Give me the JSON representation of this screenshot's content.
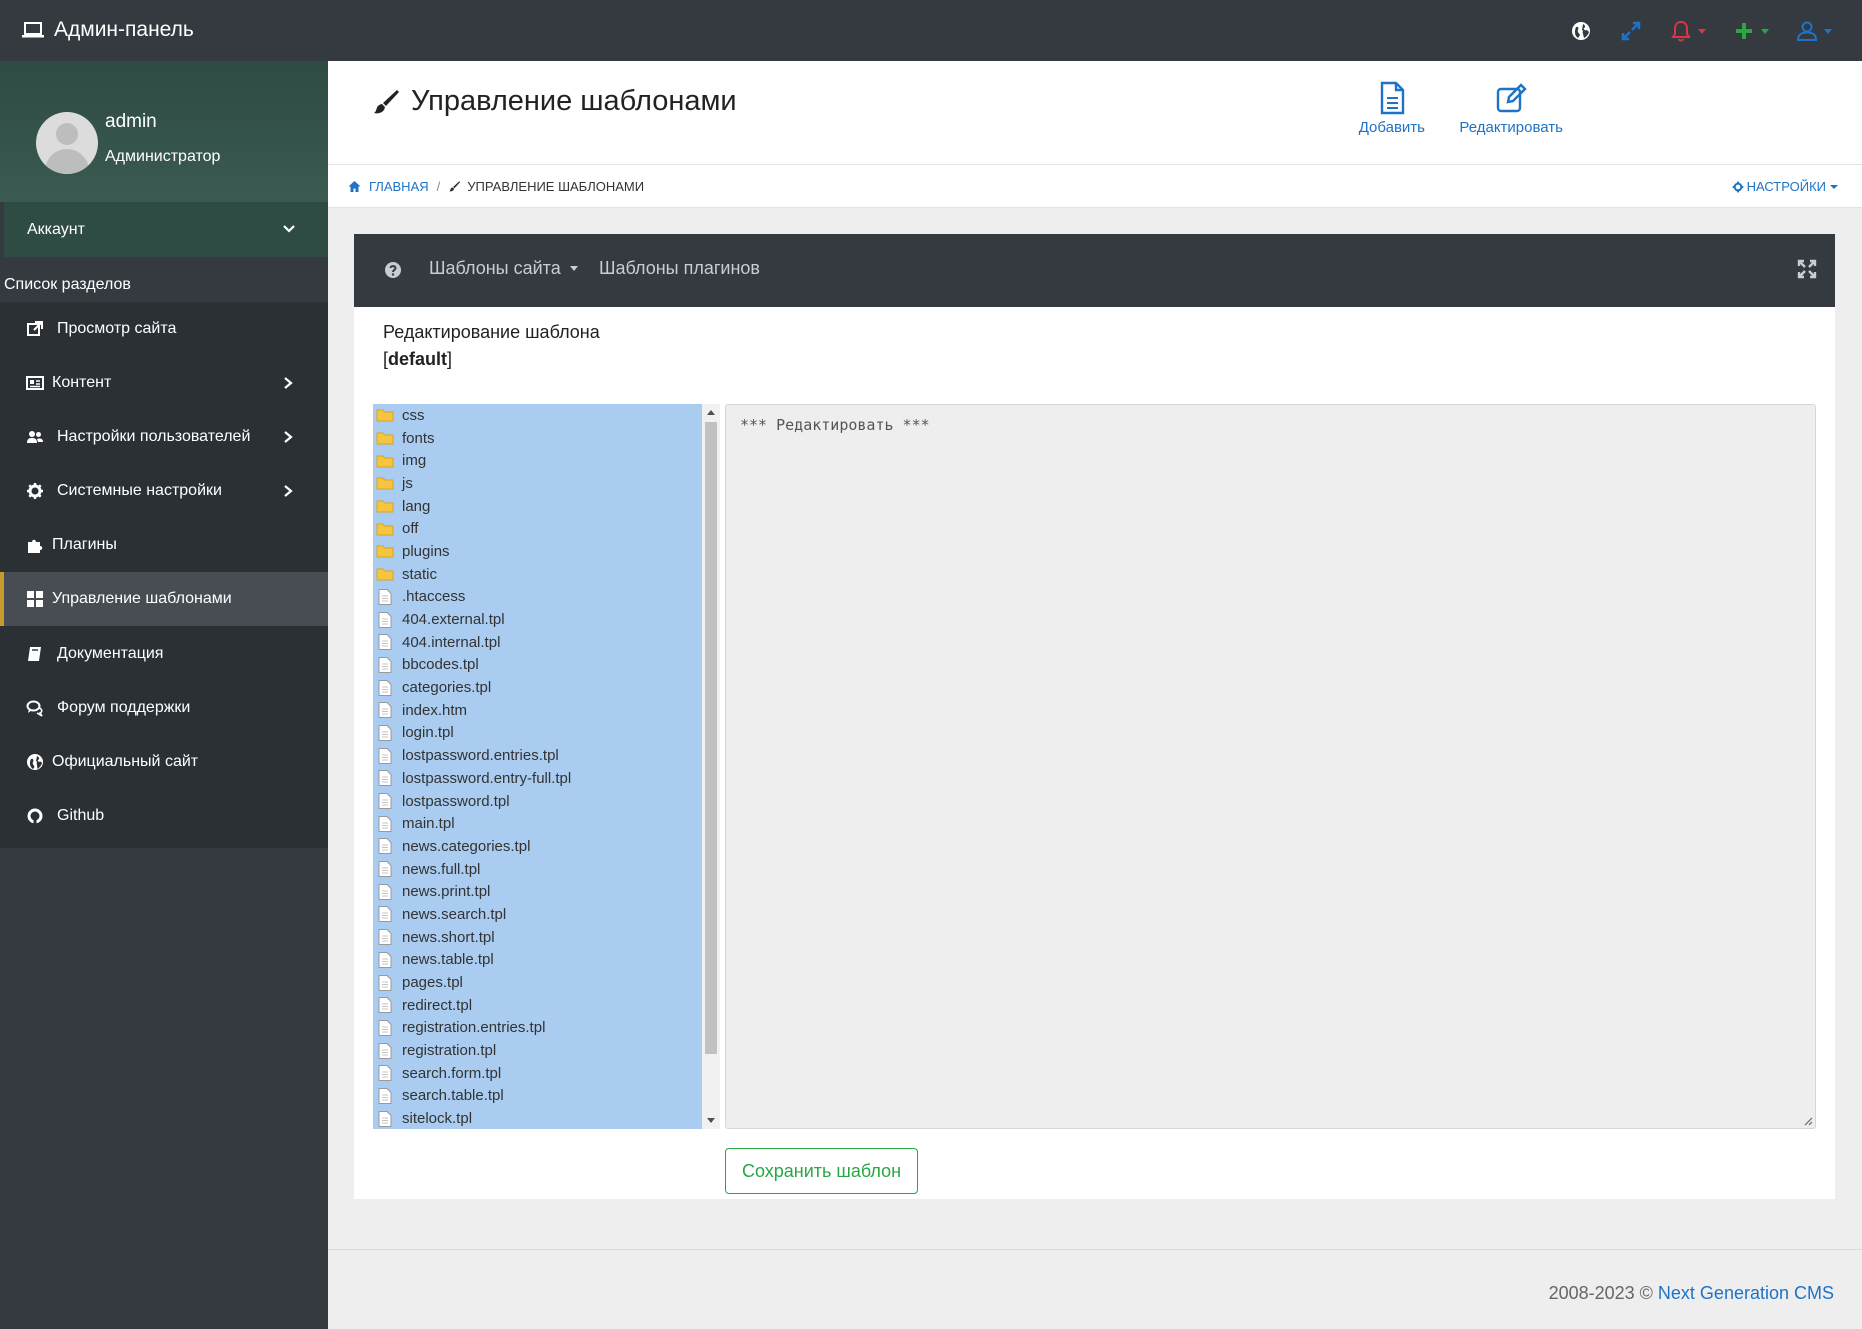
{
  "app": {
    "title": "Админ-панель"
  },
  "top_icons": [
    {
      "icon": "globe-icon",
      "color": "#ffffff"
    },
    {
      "icon": "expand-arrows-icon",
      "color": "#1e73c6"
    },
    {
      "icon": "bell-icon",
      "color": "#dc3545"
    },
    {
      "icon": "plus-icon",
      "color": "#28a745"
    },
    {
      "icon": "user-icon",
      "color": "#1e73c6"
    }
  ],
  "sidebar": {
    "user_name": "admin",
    "user_role": "Администратор",
    "account_label": "Аккаунт",
    "section_title": "Список разделов",
    "items": [
      {
        "label": "Просмотр сайта",
        "icon": "external-link-icon"
      },
      {
        "label": "Контент",
        "icon": "newspaper-icon"
      },
      {
        "label": "Настройки пользователей",
        "icon": "users-icon"
      },
      {
        "label": "Системные настройки",
        "icon": "cog-icon"
      },
      {
        "label": "Плагины",
        "icon": "puzzle-icon"
      },
      {
        "label": "Управление шаблонами",
        "icon": "th-large-icon"
      },
      {
        "label": "Документация",
        "icon": "book-icon"
      },
      {
        "label": "Форум поддержки",
        "icon": "comments-icon"
      },
      {
        "label": "Официальный сайт",
        "icon": "globe-icon"
      },
      {
        "label": "Github",
        "icon": "github-icon"
      }
    ],
    "active_item": "Управление шаблонами"
  },
  "header": {
    "title": "Управление шаблонами",
    "add_label": "Добавить",
    "edit_label": "Редактировать"
  },
  "breadcrumb": {
    "home": "ГЛАВНАЯ",
    "separator": "/",
    "current": "УПРАВЛЕНИЕ ШАБЛОНАМИ",
    "settings": "НАСТРОЙКИ"
  },
  "card": {
    "tab_site": "Шаблоны сайта",
    "tab_plugins": "Шаблоны плагинов",
    "edit_title": "Редактирование шаблона",
    "template_open": "[",
    "template_name": "default",
    "template_close": "]"
  },
  "files": [
    {
      "name": "css",
      "type": "folder"
    },
    {
      "name": "fonts",
      "type": "folder"
    },
    {
      "name": "img",
      "type": "folder"
    },
    {
      "name": "js",
      "type": "folder"
    },
    {
      "name": "lang",
      "type": "folder"
    },
    {
      "name": "off",
      "type": "folder"
    },
    {
      "name": "plugins",
      "type": "folder"
    },
    {
      "name": "static",
      "type": "folder"
    },
    {
      "name": ".htaccess",
      "type": "file"
    },
    {
      "name": "404.external.tpl",
      "type": "file"
    },
    {
      "name": "404.internal.tpl",
      "type": "file"
    },
    {
      "name": "bbcodes.tpl",
      "type": "file"
    },
    {
      "name": "categories.tpl",
      "type": "file"
    },
    {
      "name": "index.htm",
      "type": "file"
    },
    {
      "name": "login.tpl",
      "type": "file"
    },
    {
      "name": "lostpassword.entries.tpl",
      "type": "file"
    },
    {
      "name": "lostpassword.entry-full.tpl",
      "type": "file"
    },
    {
      "name": "lostpassword.tpl",
      "type": "file"
    },
    {
      "name": "main.tpl",
      "type": "file"
    },
    {
      "name": "news.categories.tpl",
      "type": "file"
    },
    {
      "name": "news.full.tpl",
      "type": "file"
    },
    {
      "name": "news.print.tpl",
      "type": "file"
    },
    {
      "name": "news.search.tpl",
      "type": "file"
    },
    {
      "name": "news.short.tpl",
      "type": "file"
    },
    {
      "name": "news.table.tpl",
      "type": "file"
    },
    {
      "name": "pages.tpl",
      "type": "file"
    },
    {
      "name": "redirect.tpl",
      "type": "file"
    },
    {
      "name": "registration.entries.tpl",
      "type": "file"
    },
    {
      "name": "registration.tpl",
      "type": "file"
    },
    {
      "name": "search.form.tpl",
      "type": "file"
    },
    {
      "name": "search.table.tpl",
      "type": "file"
    },
    {
      "name": "sitelock.tpl",
      "type": "file"
    }
  ],
  "editor": {
    "placeholder": "*** Редактировать ***"
  },
  "save_button": "Сохранить шаблон",
  "footer": {
    "years": "2008-2023 ©",
    "link": "Next Generation CMS"
  },
  "colors": {
    "navbar": "#343a40",
    "sidebar_panel": "#2e4b44",
    "accent_blue": "#1e73c6",
    "file_list_bg": "#a9ccf0",
    "save_green": "#28a745",
    "active_marker": "#c99a2e"
  }
}
